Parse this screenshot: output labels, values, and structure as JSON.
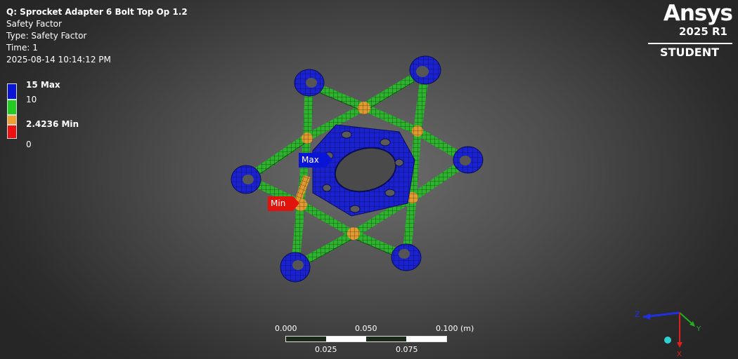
{
  "info": {
    "title": "Q: Sprocket Adapter 6 Bolt Top Op 1.2",
    "line1": "Safety Factor",
    "line2": "Type: Safety Factor",
    "line3": "Time: 1",
    "line4": "2025-08-14 10:14:12 PM"
  },
  "legend": {
    "items": [
      {
        "label": "15 Max",
        "color": "#0a14d6"
      },
      {
        "label": "10",
        "color": "#22cc22"
      },
      {
        "label": "2.4236 Min",
        "color": "#f0a030"
      },
      {
        "label": "0",
        "color": "#f01010"
      }
    ]
  },
  "logo": {
    "name": "Ansys",
    "version": "2025 R1",
    "edition": "STUDENT"
  },
  "probes": {
    "max": "Max",
    "min": "Min"
  },
  "scale": {
    "top": [
      "0.000",
      "0.050",
      "0.100 (m)"
    ],
    "bottom": [
      "0.025",
      "0.075"
    ]
  },
  "triad": {
    "x": "X",
    "y": "Y",
    "z": "Z"
  },
  "icons": {
    "axis_triad": "axis-triad-icon",
    "isometric_ball": "iso-ball-icon"
  }
}
